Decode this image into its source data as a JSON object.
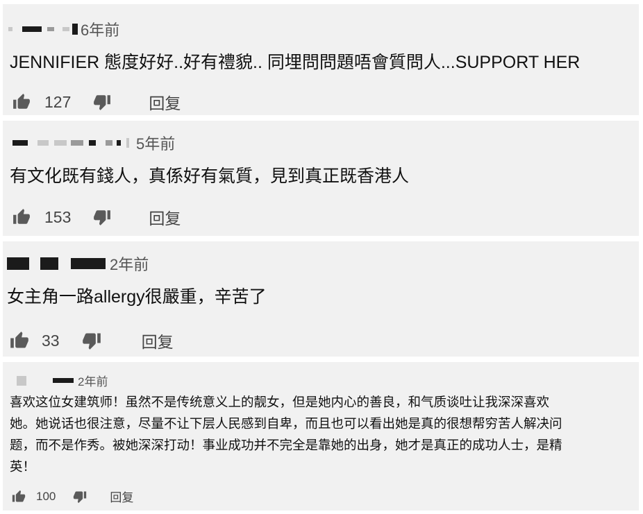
{
  "comments": [
    {
      "time": "6年前",
      "text": "JENNIFIER 態度好好..好有禮貌.. 同埋問問題唔會質問人...SUPPORT HER",
      "likes": "127",
      "reply_label": "回复"
    },
    {
      "time": "5年前",
      "text": "有文化既有錢人，真係好有氣質，見到真正既香港人",
      "likes": "153",
      "reply_label": "回复"
    },
    {
      "time": "2年前",
      "text": "女主角一路allergy很嚴重，辛苦了",
      "likes": "33",
      "reply_label": "回复"
    },
    {
      "time": "2年前",
      "text_lines": [
        "喜欢这位女建筑师！虽然不是传统意义上的靓女，但是她内心的善良，和气质谈吐让我深深喜欢",
        "她。她说话也很注意，尽量不让下层人民感到自卑，而且也可以看出她是真的很想帮穷苦人解决问",
        "题，而不是作秀。被她深深打动！事业成功并不完全是靠她的出身，她才是真正的成功人士，是精",
        "英！"
      ],
      "likes": "100",
      "reply_label": "回复"
    }
  ],
  "icons": {
    "like": "thumbs-up-icon",
    "dislike": "thumbs-down-icon"
  }
}
